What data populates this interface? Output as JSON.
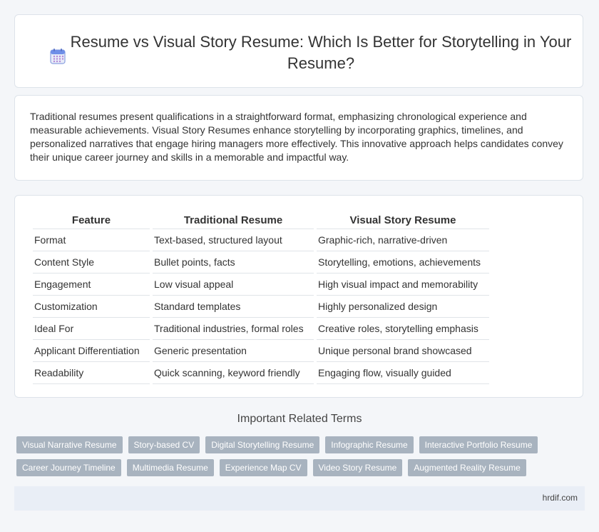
{
  "header": {
    "title": "Resume vs Visual Story Resume: Which Is Better for Storytelling in Your Resume?",
    "icon": "calendar-icon"
  },
  "intro": "Traditional resumes present qualifications in a straightforward format, emphasizing chronological experience and measurable achievements. Visual Story Resumes enhance storytelling by incorporating graphics, timelines, and personalized narratives that engage hiring managers more effectively. This innovative approach helps candidates convey their unique career journey and skills in a memorable and impactful way.",
  "table": {
    "headers": [
      "Feature",
      "Traditional Resume",
      "Visual Story Resume"
    ],
    "rows": [
      [
        "Format",
        "Text-based, structured layout",
        "Graphic-rich, narrative-driven"
      ],
      [
        "Content Style",
        "Bullet points, facts",
        "Storytelling, emotions, achievements"
      ],
      [
        "Engagement",
        "Low visual appeal",
        "High visual impact and memorability"
      ],
      [
        "Customization",
        "Standard templates",
        "Highly personalized design"
      ],
      [
        "Ideal For",
        "Traditional industries, formal roles",
        "Creative roles, storytelling emphasis"
      ],
      [
        "Applicant Differentiation",
        "Generic presentation",
        "Unique personal brand showcased"
      ],
      [
        "Readability",
        "Quick scanning, keyword friendly",
        "Engaging flow, visually guided"
      ]
    ]
  },
  "related": {
    "title": "Important Related Terms",
    "tags": [
      "Visual Narrative Resume",
      "Story-based CV",
      "Digital Storytelling Resume",
      "Infographic Resume",
      "Interactive Portfolio Resume",
      "Career Journey Timeline",
      "Multimedia Resume",
      "Experience Map CV",
      "Video Story Resume",
      "Augmented Reality Resume"
    ]
  },
  "footer": {
    "site": "hrdif.com"
  }
}
